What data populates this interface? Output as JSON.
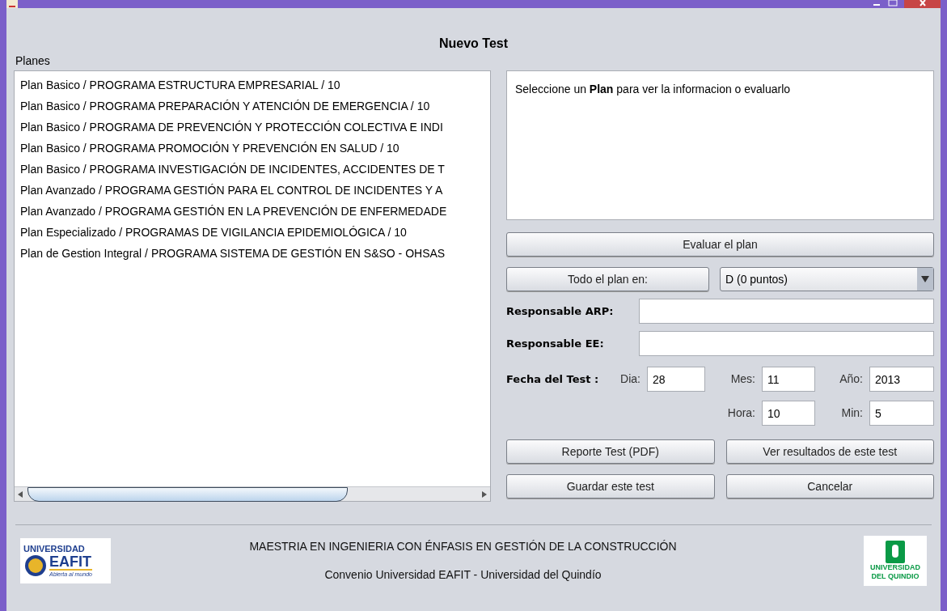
{
  "window": {
    "title": "Nuevo Test"
  },
  "plans_label": "Planes",
  "plans": [
    {
      "text": "Plan Basico / PROGRAMA ESTRUCTURA EMPRESARIAL  / 10"
    },
    {
      "text": "Plan Basico / PROGRAMA PREPARACIÓN Y ATENCIÓN DE EMERGENCIA  / 10"
    },
    {
      "text": "Plan Basico / PROGRAMA DE PREVENCIÓN Y PROTECCIÓN COLECTIVA E INDI"
    },
    {
      "text": "Plan Basico / PROGRAMA PROMOCIÓN Y PREVENCIÓN EN SALUD  / 10"
    },
    {
      "text": "Plan Basico / PROGRAMA INVESTIGACIÓN DE INCIDENTES, ACCIDENTES DE T"
    },
    {
      "text": "Plan Avanzado / PROGRAMA GESTIÓN PARA EL CONTROL DE INCIDENTES Y A"
    },
    {
      "text": "Plan Avanzado / PROGRAMA GESTIÓN EN LA PREVENCIÓN DE ENFERMEDADE"
    },
    {
      "text": "Plan Especializado / PROGRAMAS DE VIGILANCIA EPIDEMIOLÓGICA  / 10"
    },
    {
      "text": "Plan de Gestion Integral / PROGRAMA SISTEMA DE GESTIÓN EN S&SO - OHSAS"
    }
  ],
  "info_text": "Seleccione un **Plan** para ver la informacion o evaluarlo",
  "evaluate_button": "Evaluar el plan",
  "all_plan_button": "Todo el plan en:",
  "grade_select": {
    "value": "D (0 puntos)"
  },
  "arp": {
    "label": "Responsable ARP:"
  },
  "ee": {
    "label": "Responsable EE:"
  },
  "date_label": "Fecha del Test :",
  "date_fields": [
    {
      "label": "Dia:",
      "value": "28"
    },
    {
      "label": "Mes:",
      "value": "11"
    },
    {
      "label": "Año:",
      "value": "2013"
    }
  ],
  "time_fields": [
    {
      "label": "Hora:",
      "value": "10"
    },
    {
      "label": "Min:",
      "value": "5"
    }
  ],
  "buttons": [
    "Reporte Test (PDF)",
    "Ver resultados de este test",
    "Guardar este test",
    "Cancelar"
  ],
  "footer": {
    "line1": "MAESTRIA EN INGENIERIA CON ÉNFASIS EN GESTIÓN  DE LA CONSTRUCCIÓN",
    "line2": "Convenio Universidad EAFIT - Universidad del Quindío",
    "left_logo": {
      "top": "UNIVERSIDAD",
      "name": "EAFIT",
      "motto": "Abierta al mundo"
    },
    "right_logo": {
      "line1": "UNIVERSIDAD",
      "line2": "DEL QUINDIO"
    }
  }
}
